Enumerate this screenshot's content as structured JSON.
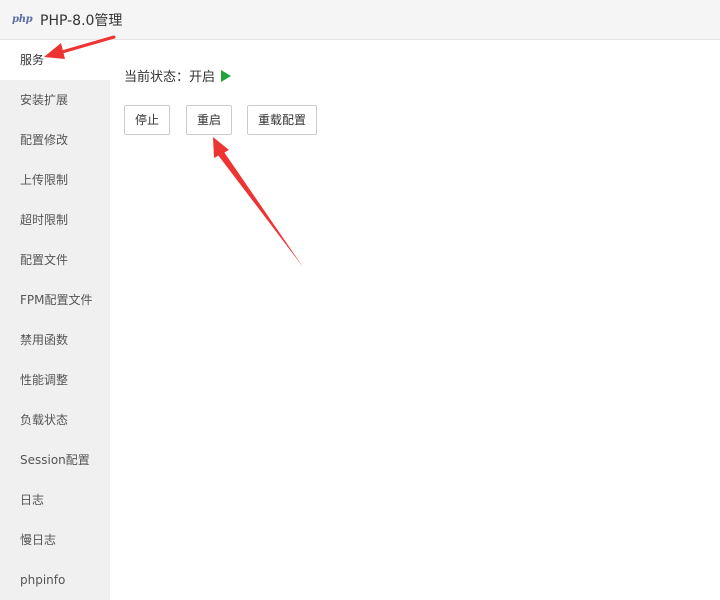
{
  "window": {
    "logo_text": "php",
    "title": "PHP-8.0管理"
  },
  "sidebar": {
    "items": [
      {
        "label": "服务",
        "active": true
      },
      {
        "label": "安装扩展"
      },
      {
        "label": "配置修改"
      },
      {
        "label": "上传限制"
      },
      {
        "label": "超时限制"
      },
      {
        "label": "配置文件"
      },
      {
        "label": "FPM配置文件"
      },
      {
        "label": "禁用函数"
      },
      {
        "label": "性能调整"
      },
      {
        "label": "负载状态"
      },
      {
        "label": "Session配置"
      },
      {
        "label": "日志"
      },
      {
        "label": "慢日志"
      },
      {
        "label": "phpinfo"
      }
    ]
  },
  "service": {
    "status_label": "当前状态：",
    "status_value": "开启",
    "status_color": "#20a53a",
    "buttons": {
      "stop": "停止",
      "restart": "重启",
      "reload": "重载配置"
    }
  },
  "colors": {
    "annotation_arrow": "#ee3333"
  }
}
